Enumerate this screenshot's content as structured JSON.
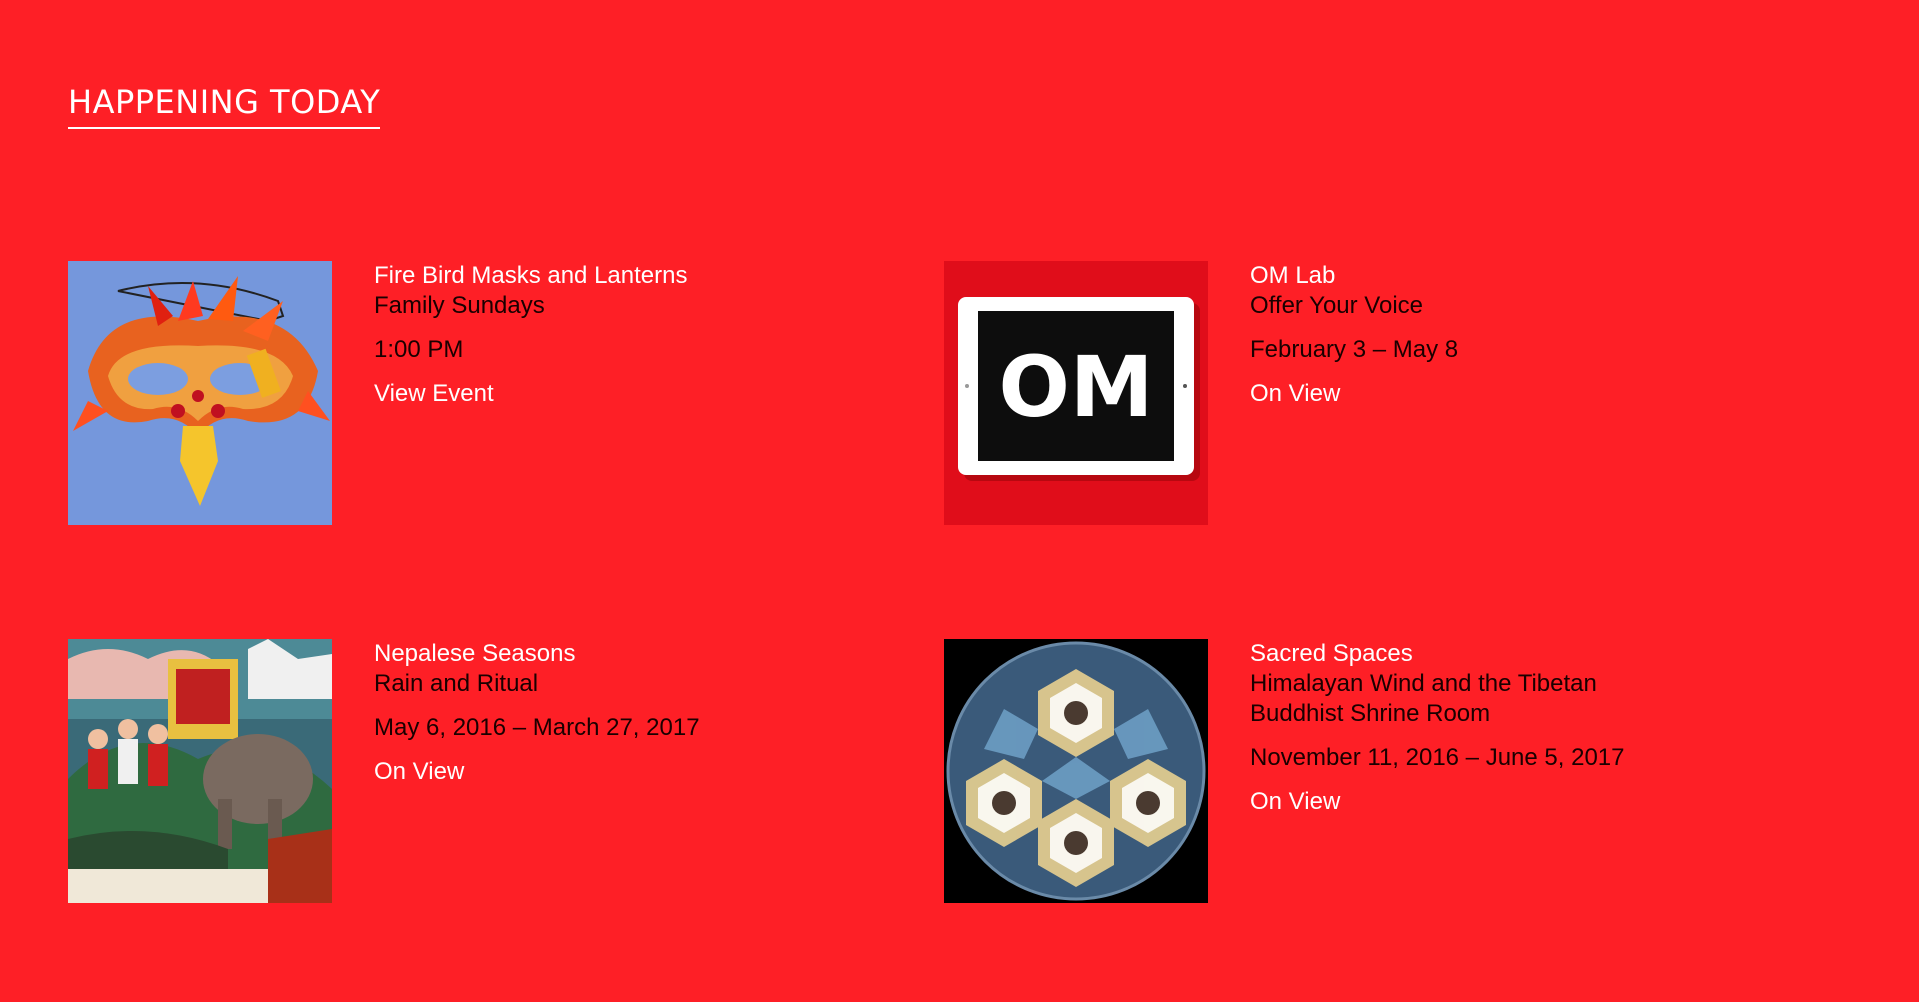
{
  "section": {
    "title": "HAPPENING TODAY"
  },
  "colors": {
    "background": "#fe1f26",
    "title_text": "#ffffff",
    "body_text": "#1a0000"
  },
  "items": [
    {
      "title": "Fire Bird Masks and Lanterns",
      "subtitle": "Family Sundays",
      "when": "1:00 PM",
      "link": "View Event",
      "image": "fire-bird-mask-image"
    },
    {
      "title": "OM Lab",
      "subtitle": "Offer Your Voice",
      "when": "February 3 – May 8",
      "link": "On View",
      "image": "om-lab-logo-image",
      "logo_text": "OM"
    },
    {
      "title": "Nepalese Seasons",
      "subtitle": "Rain and Ritual",
      "when": "May 6, 2016 – March 27, 2017",
      "link": "On View",
      "image": "nepalese-painting-image"
    },
    {
      "title": "Sacred Spaces",
      "subtitle": "Himalayan Wind and the Tibetan Buddhist Shrine Room",
      "when": "November 11, 2016 – June 5, 2017",
      "link": "On View",
      "image": "kaleidoscope-shrine-image"
    }
  ]
}
